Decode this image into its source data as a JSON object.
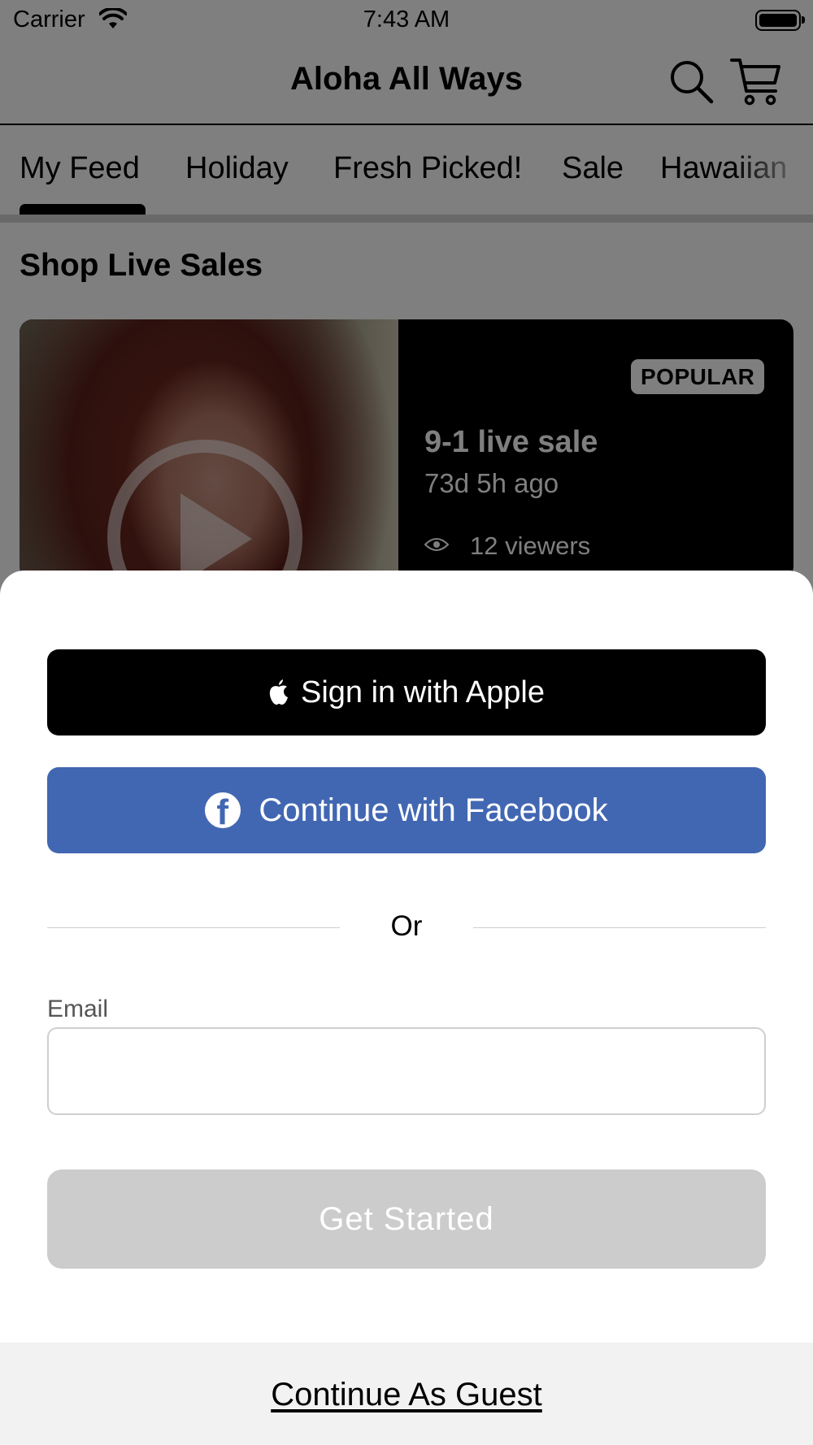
{
  "status_bar": {
    "carrier": "Carrier",
    "time": "7:43 AM"
  },
  "nav": {
    "title": "Aloha All Ways",
    "search_icon": "search-icon",
    "cart_icon": "cart-icon"
  },
  "tabs": [
    {
      "label": "My Feed",
      "selected": true
    },
    {
      "label": "Holiday",
      "selected": false
    },
    {
      "label": "Fresh Picked!",
      "selected": false
    },
    {
      "label": "Sale",
      "selected": false
    },
    {
      "label": "Hawaiian",
      "selected": false
    }
  ],
  "section": {
    "title": "Shop Live Sales"
  },
  "live_card": {
    "badge": "POPULAR",
    "title": "9-1 live sale",
    "age": "73d 5h ago",
    "viewers": "12 viewers"
  },
  "sheet": {
    "apple_button": "Sign in with Apple",
    "facebook_button": "Continue with Facebook",
    "or_label": "Or",
    "email_label": "Email",
    "email_value": "",
    "get_started_button": "Get Started",
    "guest_link": "Continue As Guest"
  },
  "colors": {
    "facebook_blue": "#4267b2",
    "apple_black": "#000000",
    "disabled_button": "#cccccc",
    "overlay": "rgba(0,0,0,0.5)",
    "guest_bar": "#f2f2f2"
  }
}
